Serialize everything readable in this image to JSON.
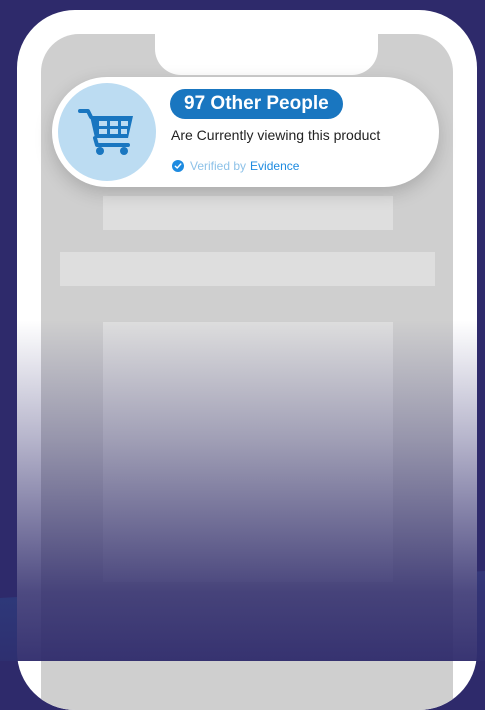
{
  "notification": {
    "headline": "97 Other People",
    "subtext": "Are Currently viewing this product",
    "verified_label": "Verified by",
    "verified_brand": "Evidence"
  },
  "icons": {
    "cart": "shopping-cart-icon",
    "verified": "check-circle-icon"
  },
  "colors": {
    "background": "#2e2a6b",
    "accent_blue": "#1976c0",
    "cart_circle": "#bcdcf2",
    "verified_text": "#8ec2e8",
    "brand_link": "#1e8be0",
    "bottom_band": "#2a8fd0"
  }
}
